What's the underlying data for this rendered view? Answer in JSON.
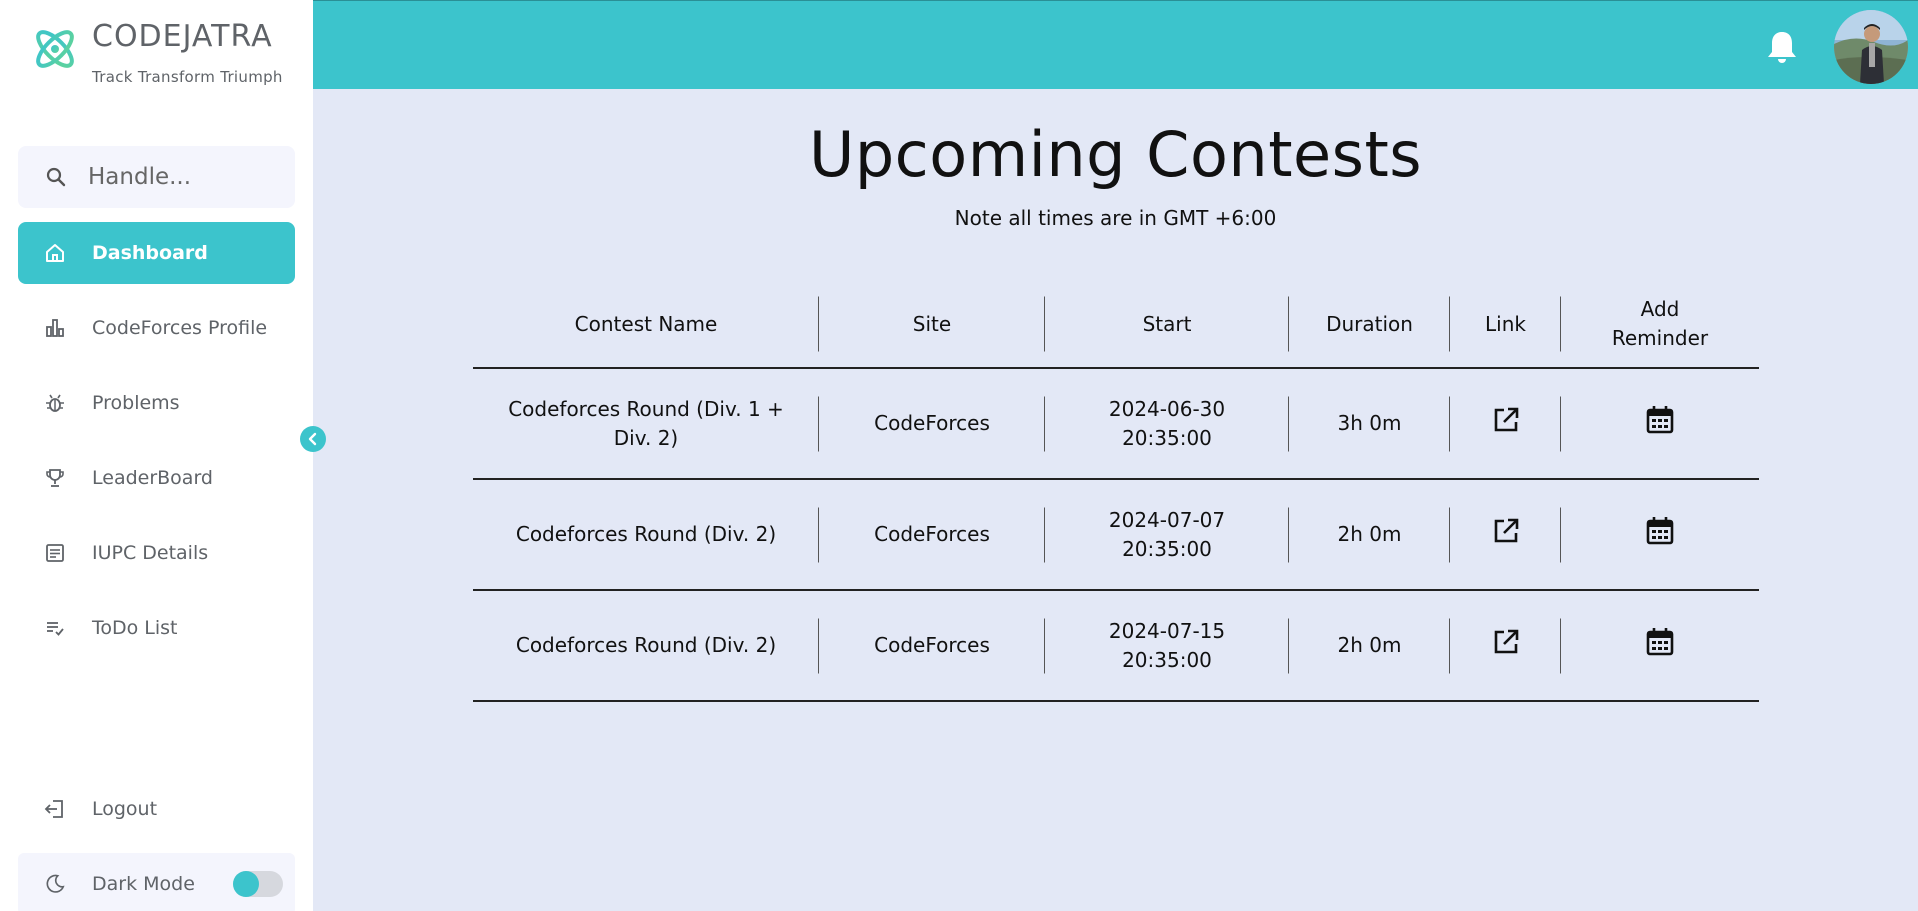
{
  "brand": {
    "name": "CODEJATRA",
    "tagline": "Track Transform Triumph",
    "logo_icon": "atom-logo-icon",
    "accent": "#3cc4cc"
  },
  "search": {
    "placeholder": "Handle..."
  },
  "sidebar": {
    "items": [
      {
        "label": "Dashboard",
        "icon": "home-icon",
        "active": true
      },
      {
        "label": "CodeForces Profile",
        "icon": "bar-chart-icon",
        "active": false
      },
      {
        "label": "Problems",
        "icon": "bug-icon",
        "active": false
      },
      {
        "label": "LeaderBoard",
        "icon": "trophy-icon",
        "active": false
      },
      {
        "label": "IUPC Details",
        "icon": "document-icon",
        "active": false
      },
      {
        "label": "ToDo List",
        "icon": "checklist-icon",
        "active": false
      }
    ],
    "logout_label": "Logout",
    "dark_mode_label": "Dark Mode"
  },
  "page": {
    "title": "Upcoming Contests",
    "note": "Note all times are in GMT +6:00"
  },
  "table": {
    "headers": {
      "name": "Contest Name",
      "site": "Site",
      "start": "Start",
      "duration": "Duration",
      "link": "Link",
      "reminder": "Add Reminder"
    },
    "rows": [
      {
        "name": "Codeforces Round (Div. 1 + Div. 2)",
        "site": "CodeForces",
        "date": "2024-06-30",
        "time": "20:35:00",
        "duration": "3h 0m"
      },
      {
        "name": "Codeforces Round (Div. 2)",
        "site": "CodeForces",
        "date": "2024-07-07",
        "time": "20:35:00",
        "duration": "2h 0m"
      },
      {
        "name": "Codeforces Round (Div. 2)",
        "site": "CodeForces",
        "date": "2024-07-15",
        "time": "20:35:00",
        "duration": "2h 0m"
      }
    ]
  }
}
